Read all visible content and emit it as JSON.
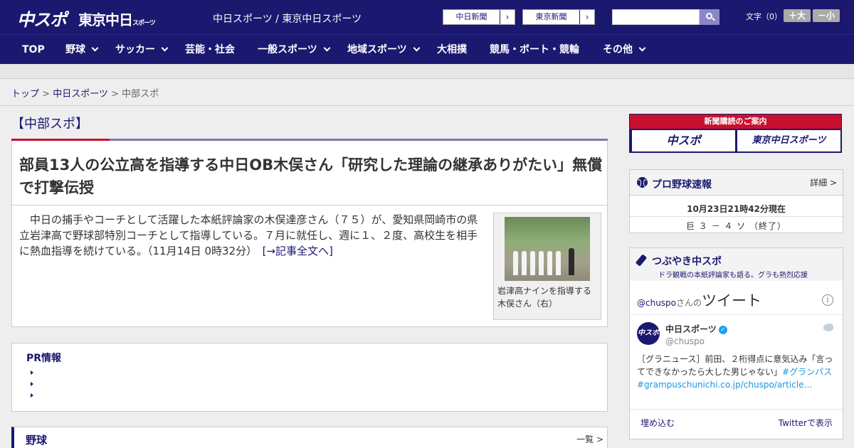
{
  "header": {
    "logo_chuspo": "中スポ",
    "logo_tokyo": "東京中日",
    "logo_tokyo_small": "スポーツ",
    "sites": "中日スポーツ / 東京中日スポーツ",
    "links": [
      {
        "label": "中日新聞"
      },
      {
        "label": "東京新聞"
      }
    ],
    "search": {
      "value": "",
      "placeholder": ""
    },
    "fontsize_label": "文字（0）",
    "font_larger": "＋大",
    "font_smaller": "－小"
  },
  "nav": {
    "items": [
      {
        "label": "TOP"
      },
      {
        "label": "野球"
      },
      {
        "label": "サッカー"
      },
      {
        "label": "芸能・社会"
      },
      {
        "label": "一般スポーツ"
      },
      {
        "label": "地域スポーツ"
      },
      {
        "label": "大相撲"
      },
      {
        "label": "競馬・ボート・競輪"
      },
      {
        "label": "その他"
      }
    ]
  },
  "breadcrumb": {
    "top": "トップ",
    "sep1": " > ",
    "chunichi": "中日スポーツ",
    "sep2": " > ",
    "current": "中部スポ"
  },
  "article": {
    "section": "【中部スポ】",
    "headline": "部員13人の公立高を指導する中日OB木俣さん「研究した理論の継承ありがたい」無償で打撃伝授",
    "lead": "中日の捕手やコーチとして活躍した本紙評論家の木俣達彦さん（７５）が、愛知県岡崎市の県立岩津高で野球部特別コーチとして指導している。７月に就任し、週に１、２度、高校生を相手に熱血指導を続けている。（11月14日 0時32分）",
    "more_link": "[→記事全文へ]",
    "photo_caption": "岩津高ナインを指導する木俣さん（右）"
  },
  "pr": {
    "title": "PR情報"
  },
  "baseball_section": {
    "title": "野球",
    "more": "一覧 >"
  },
  "sidebar": {
    "ad": {
      "head": "新聞購読のご案内",
      "chuspo": "中スポ",
      "tokyo": "東京中日スポーツ"
    },
    "score": {
      "title": "プロ野球速報",
      "detail": "詳細 >",
      "time": "10月23日21時42分現在",
      "line": "巨 ３ － ４ ソ （終了）"
    },
    "tweets": {
      "title": "つぶやき中スポ",
      "subtitle": "ドラ観戦の本紙評論家も語る。グラも熱烈応援",
      "handle": "@chuspo",
      "handle_suffix": "さんの",
      "heading": "ツイート",
      "avatar_text": "中スポ",
      "name": "中日スポーツ",
      "user_id": "@chuspo",
      "text": "［グラニュース］前田、２桁得点に意気込み「言ってできなかったら大した男じゃない」",
      "hashtag": "#グランパス",
      "url": "#grampuschunichi.co.jp/chuspo/article…",
      "embed": "埋め込む",
      "view_on_twitter": "Twitterで表示"
    }
  },
  "colors": {
    "brand_navy": "#1b1870",
    "accent_red": "#c8102e",
    "twitter_blue": "#1da1f2"
  }
}
